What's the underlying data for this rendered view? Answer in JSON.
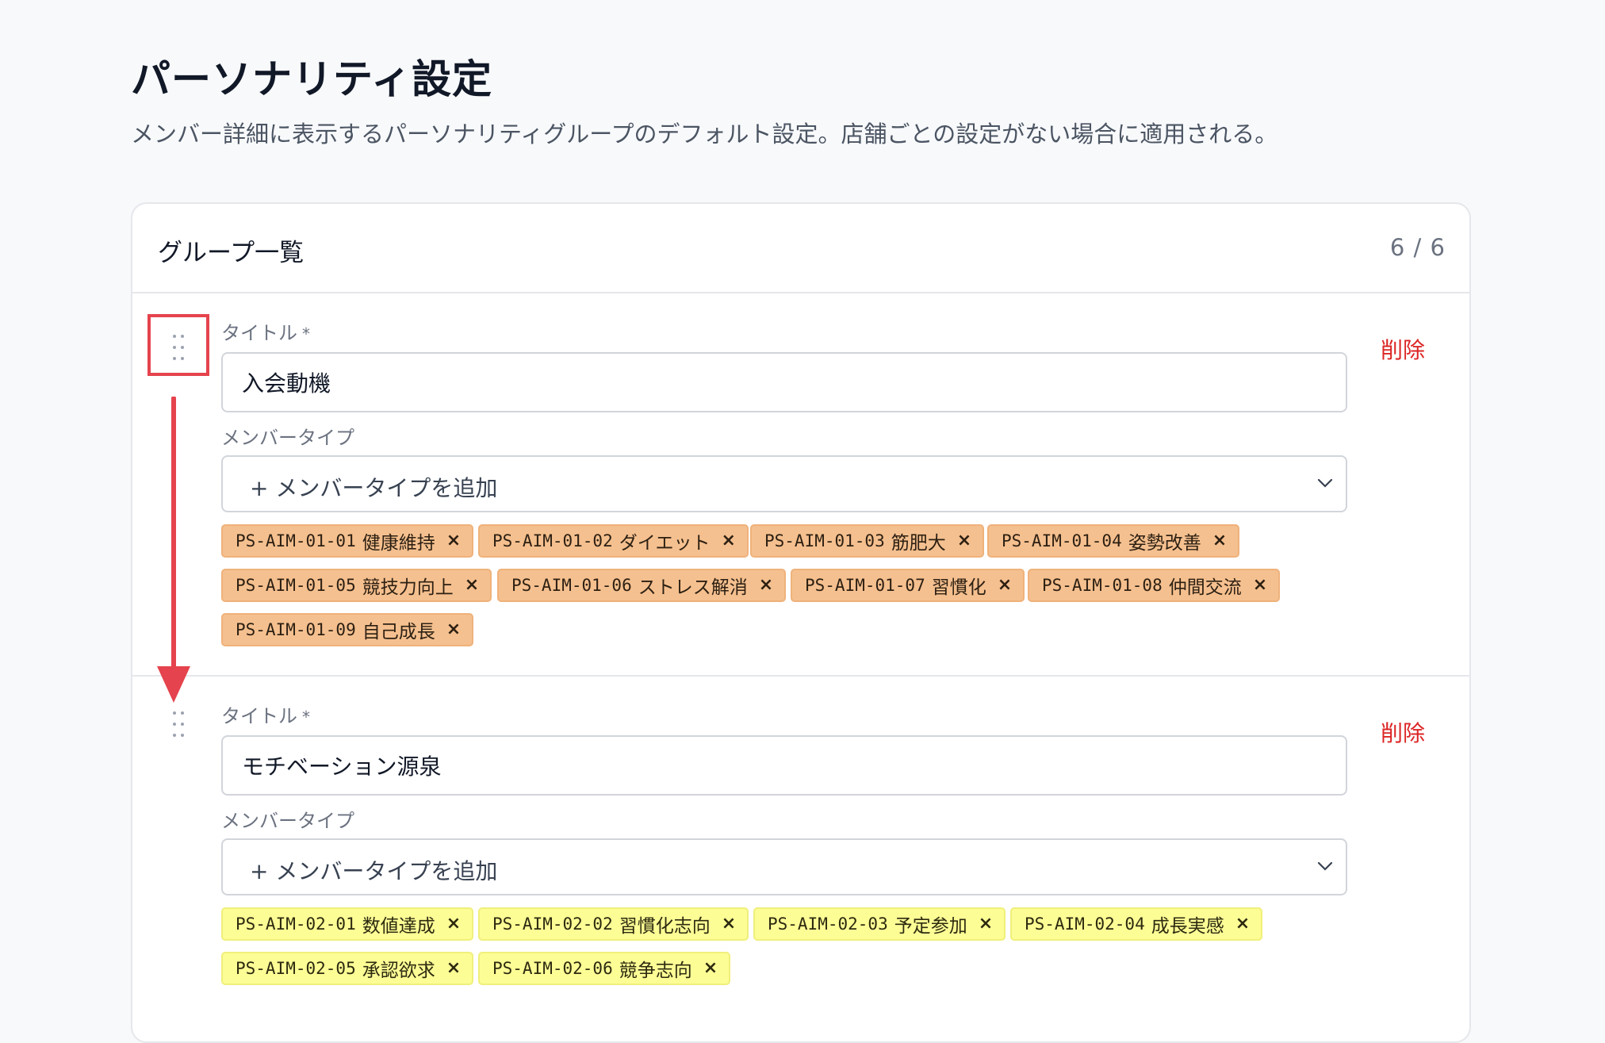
{
  "page": {
    "title": "パーソナリティ設定",
    "description": "メンバー詳細に表示するパーソナリティグループのデフォルト設定。店舗ごとの設定がない場合に適用される。"
  },
  "card": {
    "title": "グループ一覧",
    "count": "6 / 6"
  },
  "labels": {
    "title": "タイトル",
    "required": "*",
    "member_type": "メンバータイプ",
    "add_member_type": "+ メンバータイプを追加",
    "delete": "削除",
    "remove": "×"
  },
  "groups": [
    {
      "title_value": "入会動機",
      "tag_color": "#f5c08f",
      "tags": [
        {
          "code": "PS-AIM-01-01",
          "name": "健康維持"
        },
        {
          "code": "PS-AIM-01-02",
          "name": "ダイエット"
        },
        {
          "code": "PS-AIM-01-03",
          "name": "筋肥大"
        },
        {
          "code": "PS-AIM-01-04",
          "name": "姿勢改善"
        },
        {
          "code": "PS-AIM-01-05",
          "name": "競技力向上"
        },
        {
          "code": "PS-AIM-01-06",
          "name": "ストレス解消"
        },
        {
          "code": "PS-AIM-01-07",
          "name": "習慣化"
        },
        {
          "code": "PS-AIM-01-08",
          "name": "仲間交流"
        },
        {
          "code": "PS-AIM-01-09",
          "name": "自己成長"
        }
      ]
    },
    {
      "title_value": "モチベーション源泉",
      "tag_color": "#fdfd96",
      "tags": [
        {
          "code": "PS-AIM-02-01",
          "name": "数値達成"
        },
        {
          "code": "PS-AIM-02-02",
          "name": "習慣化志向"
        },
        {
          "code": "PS-AIM-02-03",
          "name": "予定参加"
        },
        {
          "code": "PS-AIM-02-04",
          "name": "成長実感"
        },
        {
          "code": "PS-AIM-02-05",
          "name": "承認欲求"
        },
        {
          "code": "PS-AIM-02-06",
          "name": "競争志向"
        }
      ]
    }
  ],
  "colors": {
    "delete": "#dc2626",
    "annotation": "#e5434d",
    "tag_orange": "#f5c08f",
    "tag_yellow": "#fdfd96"
  }
}
